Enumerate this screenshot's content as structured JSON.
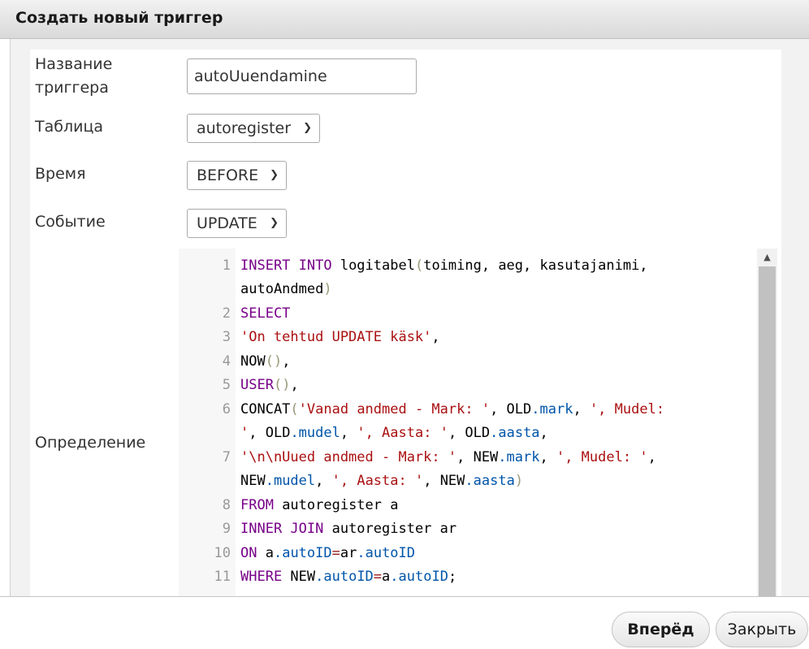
{
  "dialog": {
    "title": "Создать новый триггер"
  },
  "form": {
    "name_label": "Название триггера",
    "name_value": "autoUuendamine",
    "table_label": "Таблица",
    "table_value": "autoregister",
    "time_label": "Время",
    "time_value": "BEFORE",
    "event_label": "Событие",
    "event_value": "UPDATE",
    "definition_label": "Определение"
  },
  "editor": {
    "line_numbers": [
      "1",
      "2",
      "3",
      "4",
      "5",
      "6",
      "7",
      "8",
      "9",
      "10",
      "11"
    ],
    "lines": {
      "l1a": {
        "kw1": "INSERT INTO",
        "t1": " logitabel",
        "b1": "(",
        "t2": "toiming, aeg, kasutajanimi,"
      },
      "l1b": {
        "t1": "autoAndmed",
        "b1": ")"
      },
      "l2": {
        "kw1": "SELECT"
      },
      "l3": {
        "s1": "'On tehtud UPDATE käsk'",
        "t1": ","
      },
      "l4": {
        "t1": "NOW",
        "b1": "()",
        "t2": ","
      },
      "l5": {
        "kw1": "USER",
        "b1": "()",
        "t1": ","
      },
      "l6a": {
        "t1": "CONCAT",
        "b1": "(",
        "s1": "'Vanad andmed - Mark: '",
        "t2": ", OLD",
        "p1": ".mark",
        "t3": ", ",
        "s2": "', Mudel:"
      },
      "l6b": {
        "s1": "'",
        "t1": ", OLD",
        "p1": ".mudel",
        "t2": ", ",
        "s2": "', Aasta: '",
        "t3": ", OLD",
        "p2": ".aasta",
        "t4": ","
      },
      "l7a": {
        "s1": "'\\n\\nUued andmed - Mark: '",
        "t1": ", NEW",
        "p1": ".mark",
        "t2": ", ",
        "s2": "', Mudel: '",
        "t3": ","
      },
      "l7b": {
        "t1": "NEW",
        "p1": ".mudel",
        "t2": ", ",
        "s1": "', Aasta: '",
        "t3": ", NEW",
        "p2": ".aasta",
        "b1": ")"
      },
      "l8": {
        "kw1": "FROM",
        "t1": " autoregister a"
      },
      "l9": {
        "kw1": "INNER JOIN",
        "t1": " autoregister ar"
      },
      "l10": {
        "kw1": "ON",
        "t1": " a",
        "p1": ".autoID",
        "o1": "=",
        "t2": "ar",
        "p2": ".autoID"
      },
      "l11": {
        "kw1": "WHERE",
        "t1": " NEW",
        "p1": ".autoID",
        "o1": "=",
        "t2": "a",
        "p2": ".autoID",
        "t3": ";"
      }
    }
  },
  "buttons": {
    "forward": "Вперёд",
    "close": "Закрыть"
  },
  "icons": {
    "select_chevron": "chevron-down-icon",
    "scroll_up": "scroll-up-arrow-icon"
  },
  "colors": {
    "keyword": "#770088",
    "string": "#aa1111",
    "property": "#0055aa",
    "operator": "#981a1a",
    "bracket": "#999977"
  }
}
